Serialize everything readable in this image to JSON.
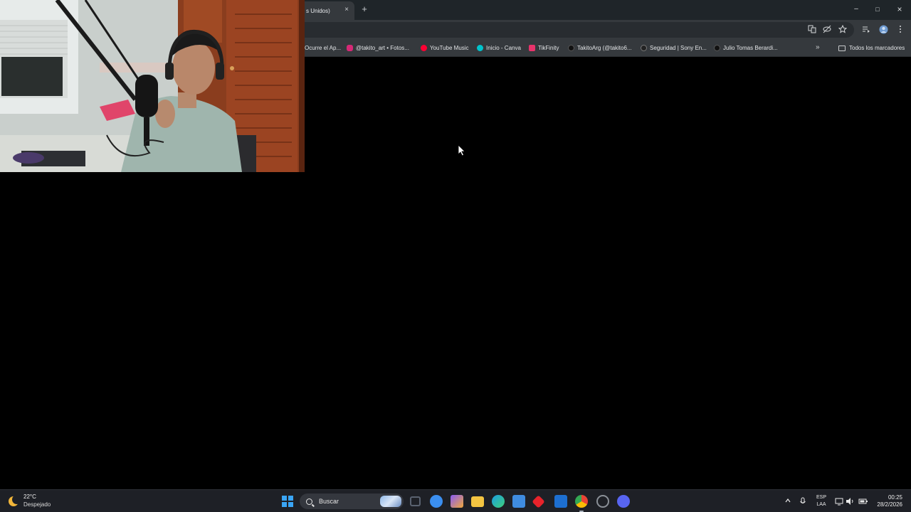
{
  "browser": {
    "active_tab_title": "s Unidos)",
    "new_tab_symbol": "+",
    "close_tab_symbol": "×",
    "window_controls": {
      "minimize": "–",
      "maximize": "□",
      "close": "×"
    },
    "toolbar_icons": [
      "translate-icon",
      "eye-off-icon",
      "star-icon",
      "media-controls-icon",
      "profile-icon",
      "menu-icon"
    ],
    "bookmarks": [
      {
        "label": "Ocurre el Ap...",
        "icon": "globe-icon",
        "color": "#5f6368"
      },
      {
        "label": "@takito_art • Fotos...",
        "icon": "instagram-icon",
        "color": "#d62976"
      },
      {
        "label": "YouTube Music",
        "icon": "youtube-music-icon",
        "color": "#ff0033"
      },
      {
        "label": "Inicio - Canva",
        "icon": "canva-icon",
        "color": "#00c4cc"
      },
      {
        "label": "TikFinity",
        "icon": "tikfinity-icon",
        "color": "#e8336b"
      },
      {
        "label": "TakitoArg (@takito6...",
        "icon": "tiktok-icon",
        "color": "#111111"
      },
      {
        "label": "Seguridad | Sony En...",
        "icon": "sony-icon",
        "color": "#222222"
      },
      {
        "label": "Julio Tomas Berardi...",
        "icon": "tiktok-icon",
        "color": "#111111"
      }
    ],
    "bookmarks_overflow": "»",
    "all_bookmarks_label": "Todos los marcadores"
  },
  "taskbar": {
    "weather": {
      "temp": "22°C",
      "condition": "Despejado",
      "icon": "moon-icon"
    },
    "search_label": "Buscar",
    "apps": [
      {
        "name": "task-view",
        "color": "#5a6270"
      },
      {
        "name": "copilot",
        "color": "#3b8ff0"
      },
      {
        "name": "copilot-app",
        "color": "#8a5cf5"
      },
      {
        "name": "file-explorer",
        "color": "#f4c542"
      },
      {
        "name": "edge",
        "color": "#1b9de2"
      },
      {
        "name": "microsoft-store",
        "color": "#3f8ce0"
      },
      {
        "name": "anydesk",
        "color": "#e8232b"
      },
      {
        "name": "outlook",
        "color": "#1d6fd1"
      },
      {
        "name": "chrome",
        "color": "#34a853"
      },
      {
        "name": "github-desktop",
        "color": "#8a8f97"
      },
      {
        "name": "discord",
        "color": "#5865f2"
      }
    ],
    "language_line1": "ESP",
    "language_line2": "LAA",
    "time": "00:25",
    "date": "28/2/2026",
    "colors": {
      "accent": "#3aa5f5",
      "background": "#1e2026"
    }
  }
}
